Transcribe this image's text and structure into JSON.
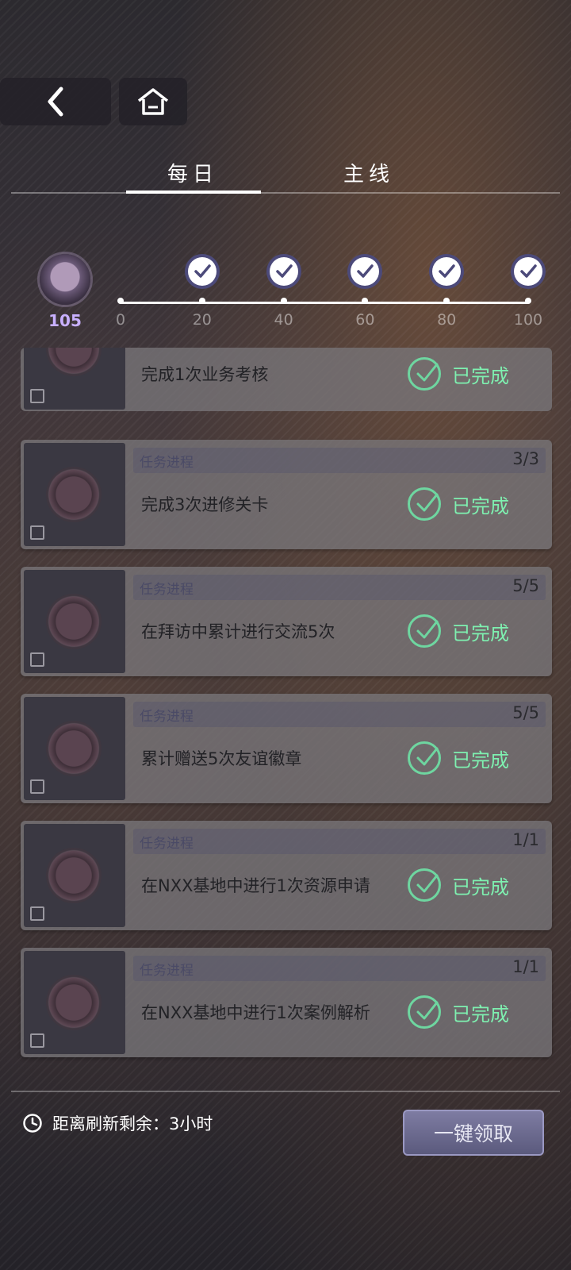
{
  "nav": {
    "back_icon": "chevron-left-icon",
    "home_icon": "home-icon"
  },
  "tabs": [
    {
      "label": "每日",
      "active": true
    },
    {
      "label": "主线",
      "active": false
    }
  ],
  "progress": {
    "points": "105",
    "point_value": 105,
    "max": 100,
    "milestones": [
      {
        "label": "0",
        "value": 0,
        "claimed": false,
        "has_icon": false
      },
      {
        "label": "20",
        "value": 20,
        "claimed": true,
        "has_icon": true
      },
      {
        "label": "40",
        "value": 40,
        "claimed": true,
        "has_icon": true
      },
      {
        "label": "60",
        "value": 60,
        "claimed": true,
        "has_icon": true
      },
      {
        "label": "80",
        "value": 80,
        "claimed": true,
        "has_icon": true
      },
      {
        "label": "100",
        "value": 100,
        "claimed": true,
        "has_icon": true
      }
    ]
  },
  "tasks": [
    {
      "header": "",
      "count": "",
      "title": "完成1次业务考核",
      "status": "已完成",
      "partial": true
    },
    {
      "header": "任务进程",
      "count": "3/3",
      "title": "完成3次进修关卡",
      "status": "已完成"
    },
    {
      "header": "任务进程",
      "count": "5/5",
      "title": "在拜访中累计进行交流5次",
      "status": "已完成"
    },
    {
      "header": "任务进程",
      "count": "5/5",
      "title": "累计赠送5次友谊徽章",
      "status": "已完成"
    },
    {
      "header": "任务进程",
      "count": "1/1",
      "title": "在NXX基地中进行1次资源申请",
      "status": "已完成"
    },
    {
      "header": "任务进程",
      "count": "1/1",
      "title": "在NXX基地中进行1次案例解析",
      "status": "已完成"
    }
  ],
  "footer": {
    "refresh_text": "距离刷新剩余：3小时",
    "claim_label": "一键领取"
  },
  "colors": {
    "done_green": "#7ef0b0",
    "points_purple": "#c8b0ff",
    "claim_button": "#6b6a90"
  }
}
